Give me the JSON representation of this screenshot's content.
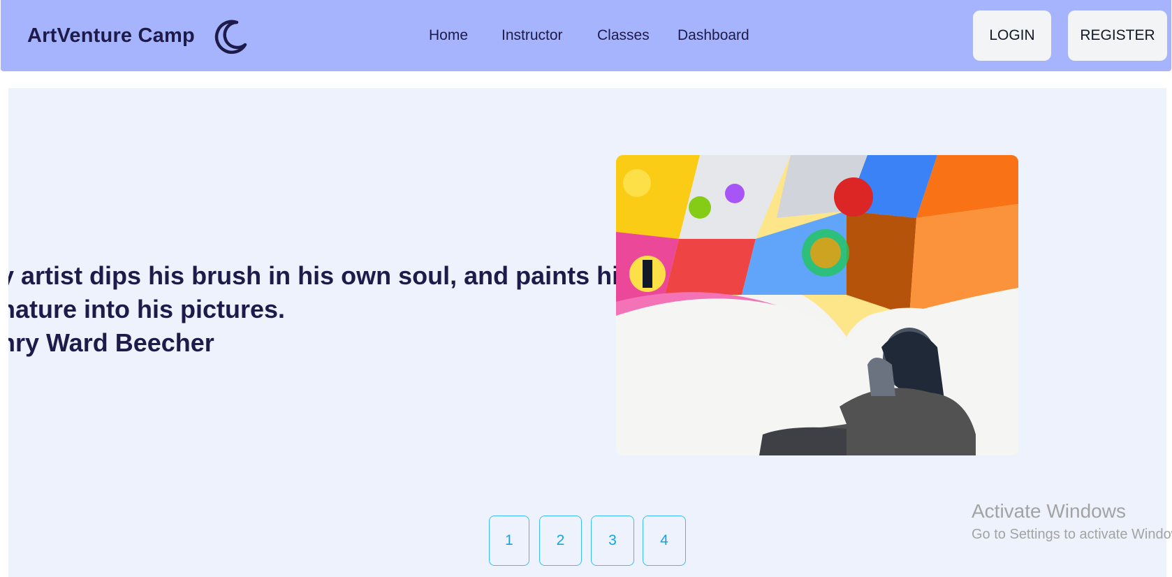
{
  "navbar": {
    "brand": "ArtVenture Camp",
    "theme_toggle_icon": "moon-icon",
    "links": [
      {
        "label": "Home"
      },
      {
        "label": "Instructor"
      },
      {
        "label": "Classes"
      },
      {
        "label": "Dashboard"
      }
    ],
    "login_label": "LOGIN",
    "register_label": "REGISTER"
  },
  "hero": {
    "quote_lines": [
      "y artist dips his brush in his own soul, and paints his",
      " nature into his pictures.",
      "nry Ward Beecher"
    ],
    "image_icon": "child-drawing-image"
  },
  "pagination": {
    "pages": [
      "1",
      "2",
      "3",
      "4"
    ]
  },
  "watermark": {
    "title": "Activate Windows",
    "subtitle": "Go to Settings to activate Windows."
  },
  "colors": {
    "navbar_bg": "#a5b4fc",
    "hero_bg": "#eef2fd",
    "text_dark": "#1e1b4b",
    "pager_accent": "#38bdf8"
  }
}
